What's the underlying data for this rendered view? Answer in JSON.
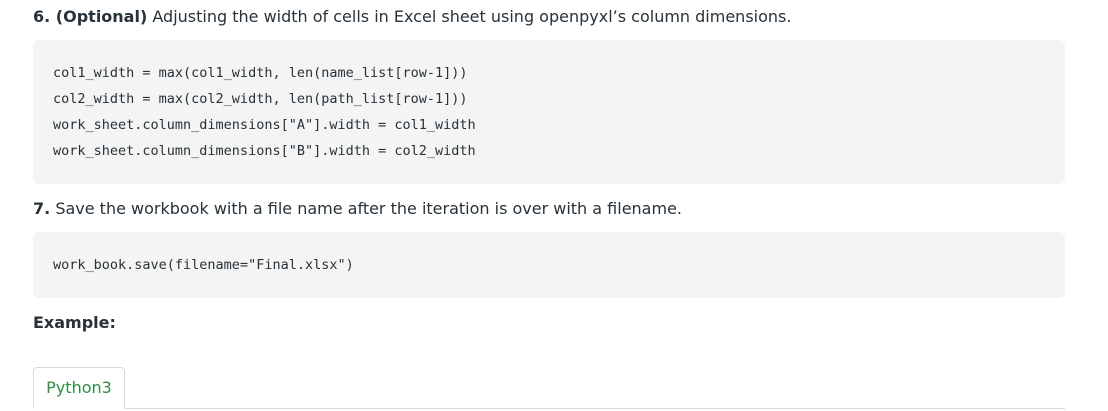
{
  "step6": {
    "number": "6.",
    "bold_label": "(Optional)",
    "text": "Adjusting the width of cells in Excel sheet using openpyxl’s column dimensions."
  },
  "code1": {
    "lines": [
      "col1_width = max(col1_width, len(name_list[row-1]))",
      "col2_width = max(col2_width, len(path_list[row-1]))",
      "work_sheet.column_dimensions[\"A\"].width = col1_width",
      "work_sheet.column_dimensions[\"B\"].width = col2_width"
    ]
  },
  "step7": {
    "number": "7.",
    "text": "Save the workbook with a file name after the iteration is over with a filename."
  },
  "code2": {
    "lines": [
      "work_book.save(filename=\"Final.xlsx\")"
    ]
  },
  "example": {
    "heading": "Example:"
  },
  "tabs": [
    {
      "label": "Python3"
    }
  ],
  "colors": {
    "text": "#273239",
    "code_background": "#f4f4f4",
    "tab_accent": "#2f8d46",
    "border": "#d9d9d9"
  }
}
